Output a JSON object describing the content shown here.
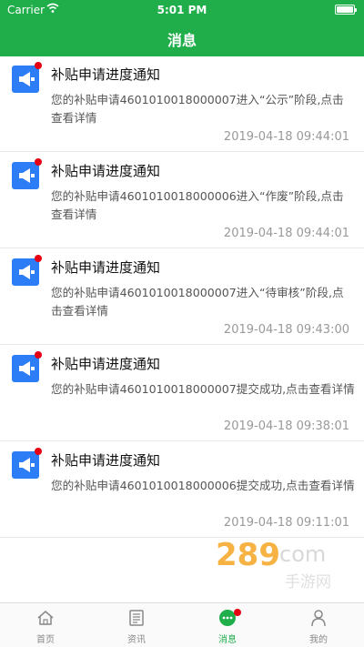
{
  "status": {
    "carrier": "Carrier",
    "time": "5:01 PM"
  },
  "header": {
    "title": "消息"
  },
  "messages": [
    {
      "title": "补贴申请进度通知",
      "body": "您的补贴申请4601010018000007进入“公示”阶段,点击查看详情",
      "time": "2019-04-18 09:44:01"
    },
    {
      "title": "补贴申请进度通知",
      "body": "您的补贴申请4601010018000006进入“作废”阶段,点击查看详情",
      "time": "2019-04-18 09:44:01"
    },
    {
      "title": "补贴申请进度通知",
      "body": "您的补贴申请4601010018000007进入“待审核”阶段,点击查看详情",
      "time": "2019-04-18 09:43:00"
    },
    {
      "title": "补贴申请进度通知",
      "body": "您的补贴申请4601010018000007提交成功,点击查看详情",
      "time": "2019-04-18 09:38:01"
    },
    {
      "title": "补贴申请进度通知",
      "body": "您的补贴申请4601010018000006提交成功,点击查看详情",
      "time": "2019-04-18 09:11:01"
    }
  ],
  "tabs": [
    {
      "label": "首页",
      "icon": "home-icon"
    },
    {
      "label": "资讯",
      "icon": "news-icon"
    },
    {
      "label": "消息",
      "icon": "message-icon"
    },
    {
      "label": "我的",
      "icon": "profile-icon"
    }
  ],
  "colors": {
    "primary": "#1fae4a",
    "accent_blue": "#2d7ef6",
    "badge_red": "#e60012"
  },
  "watermark": {
    "text": "289.com 手游网"
  }
}
